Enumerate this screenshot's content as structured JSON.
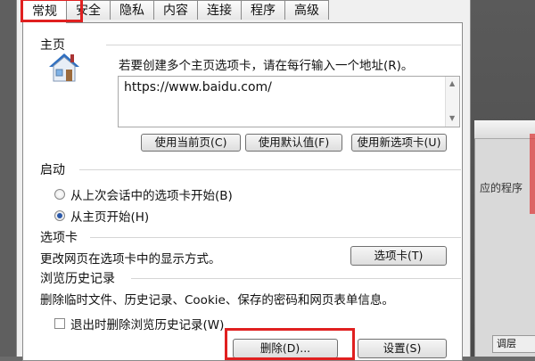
{
  "tabs": [
    "常规",
    "安全",
    "隐私",
    "内容",
    "连接",
    "程序",
    "高级"
  ],
  "homepage": {
    "section_title": "主页",
    "description": "若要创建多个主页选项卡，请在每行输入一个地址(R)。",
    "url_value": "https://www.baidu.com/",
    "use_current_label": "使用当前页(C)",
    "use_default_label": "使用默认值(F)",
    "use_new_tab_label": "使用新选项卡(U)"
  },
  "startup": {
    "section_title": "启动",
    "option_last_session": "从上次会话中的选项卡开始(B)",
    "option_homepage": "从主页开始(H)",
    "selected": "option_homepage"
  },
  "tabs_section": {
    "section_title": "选项卡",
    "description": "更改网页在选项卡中的显示方式。",
    "button_label": "选项卡(T)"
  },
  "history": {
    "section_title": "浏览历史记录",
    "description": "删除临时文件、历史记录、Cookie、保存的密码和网页表单信息。",
    "checkbox_label": "退出时删除浏览历史记录(W)",
    "checkbox_checked": false,
    "delete_label": "删除(D)...",
    "settings_label": "设置(S)"
  },
  "background": {
    "partial_text": "应的程序",
    "bottom_tab_text": "调层"
  },
  "icons": {
    "homepage_icon": "house-icon",
    "scroll_up": "chevron-up-icon",
    "scroll_down": "chevron-down-icon"
  },
  "colors": {
    "highlight_red": "#e02020",
    "radio_selected": "#2a58a8",
    "house_roof": "#2f6fc0"
  }
}
